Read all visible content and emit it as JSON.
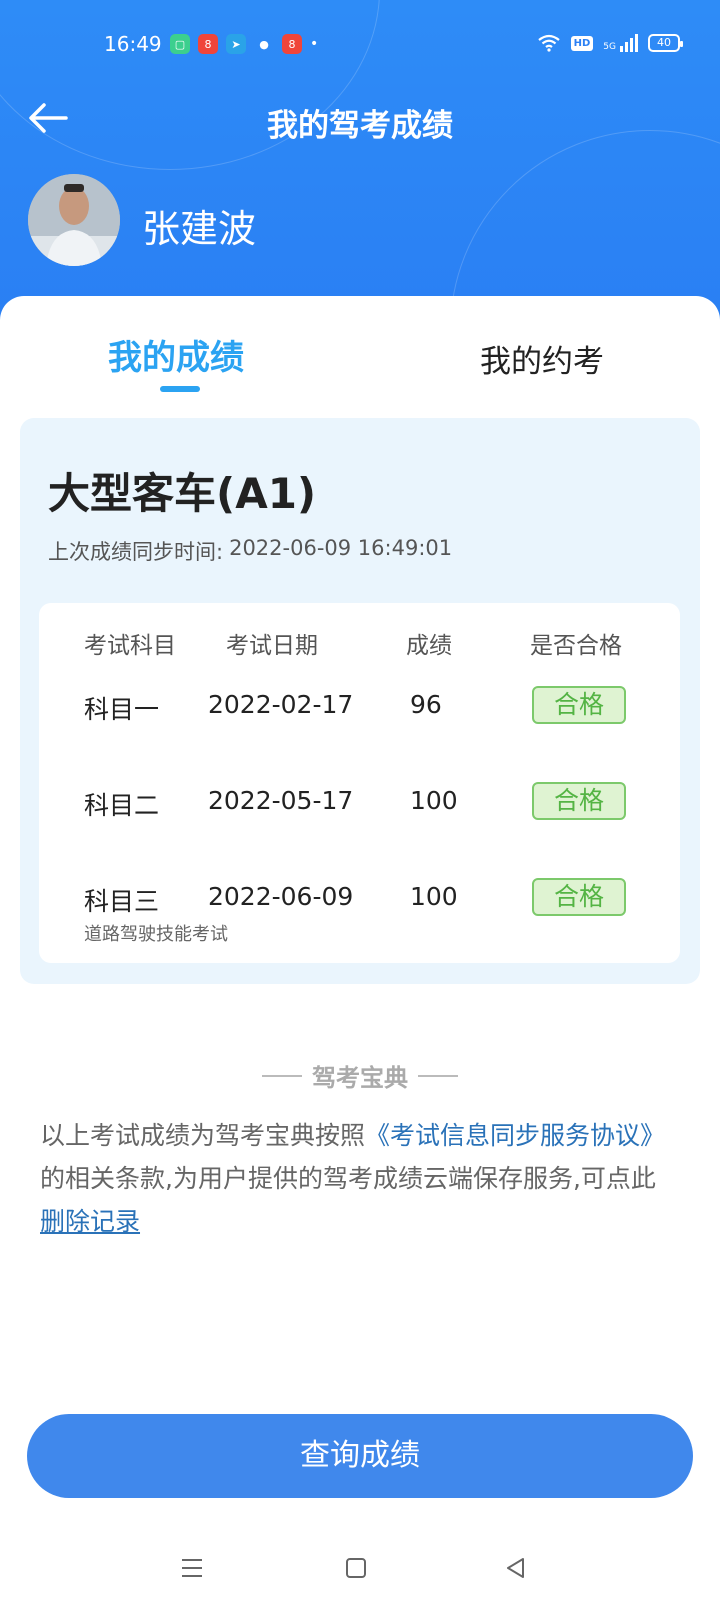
{
  "status_bar": {
    "time": "16:49",
    "battery": "40",
    "network": "5G",
    "hd": "HD",
    "app_icons": [
      "notes-app-icon",
      "app-store-icon",
      "telegram-icon",
      "chat-bubble-icon",
      "app-store-icon"
    ]
  },
  "header": {
    "title": "我的驾考成绩",
    "user_name": "张建波"
  },
  "tabs": [
    {
      "label": "我的成绩",
      "active": true
    },
    {
      "label": "我的约考",
      "active": false
    }
  ],
  "score_card": {
    "license_type": "大型客车(A1)",
    "sync_label": "上次成绩同步时间:",
    "sync_time": "2022-06-09 16:49:01",
    "columns": [
      "考试科目",
      "考试日期",
      "成绩",
      "是否合格"
    ],
    "rows": [
      {
        "subject": "科目一",
        "date": "2022-02-17",
        "score": "96",
        "result": "合格"
      },
      {
        "subject": "科目二",
        "date": "2022-05-17",
        "score": "100",
        "result": "合格"
      },
      {
        "subject": "科目三",
        "date": "2022-06-09",
        "score": "100",
        "result": "合格",
        "note": "道路驾驶技能考试"
      }
    ]
  },
  "brand": "驾考宝典",
  "agreement": {
    "prefix": "以上考试成绩为驾考宝典按照",
    "link": "《考试信息同步服务协议》",
    "middle": "的相关条款,为用户提供的驾考成绩云端保存服务,可点此",
    "delete_link": "删除记录"
  },
  "query_button": "查询成绩",
  "colors": {
    "header_blue": "#2e8cf7",
    "tab_active": "#2ba3f2",
    "pass_green": "#54b444",
    "button_blue": "#4088ec"
  }
}
